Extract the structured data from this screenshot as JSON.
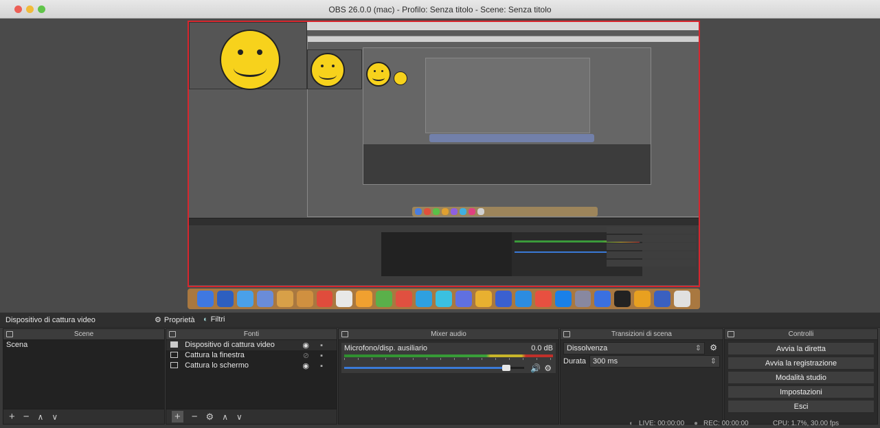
{
  "window": {
    "title": "OBS 26.0.0 (mac) - Profilo: Senza titolo - Scene: Senza titolo"
  },
  "source_bar": {
    "selected_source": "Dispositivo di cattura video",
    "properties_label": "Proprietà",
    "filters_label": "Filtri"
  },
  "scenes": {
    "header": "Scene",
    "items": [
      "Scena"
    ]
  },
  "sources": {
    "header": "Fonti",
    "items": [
      "Dispositivo di cattura video",
      "Cattura la finestra",
      "Cattura lo schermo"
    ]
  },
  "mixer": {
    "header": "Mixer audio",
    "channel": "Microfono/disp. ausiliario",
    "level": "0.0 dB",
    "volume_fraction": 0.9
  },
  "transitions": {
    "header": "Transizioni di scena",
    "selected": "Dissolvenza",
    "duration_label": "Durata",
    "duration_value": "300 ms"
  },
  "controls": {
    "header": "Controlli",
    "start_streaming": "Avvia la diretta",
    "start_recording": "Avvia la registrazione",
    "studio_mode": "Modalità studio",
    "settings": "Impostazioni",
    "exit": "Esci"
  },
  "status": {
    "live": "LIVE: 00:00:00",
    "rec": "REC: 00:00:00",
    "cpu": "CPU: 1.7%, 30.00 fps"
  },
  "colors": {
    "accent_red": "#d8262e",
    "smiley": "#f7d21c"
  }
}
